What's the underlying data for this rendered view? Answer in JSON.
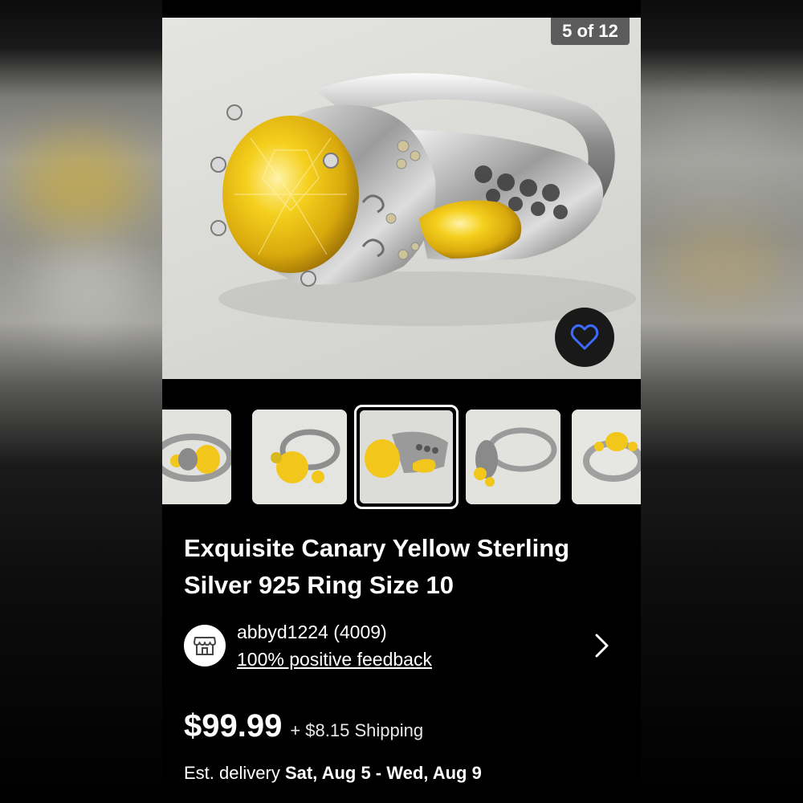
{
  "gallery": {
    "counter": "5 of 12",
    "thumbnail_count": 5,
    "selected_thumbnail": 3
  },
  "listing": {
    "title": "Exquisite Canary Yellow Sterling Silver 925 Ring Size 10",
    "price": "$99.99",
    "shipping": "+ $8.15 Shipping",
    "delivery_label": "Est. delivery",
    "delivery_dates": "Sat, Aug 5 - Wed, Aug 9"
  },
  "seller": {
    "name": "abbyd1224 (4009)",
    "feedback": "100% positive feedback"
  },
  "colors": {
    "background": "#000000",
    "favorite_icon": "#3d6bff",
    "gem": "#f2c61a"
  },
  "icons": {
    "favorite": "heart-outline-icon",
    "seller": "store-icon",
    "chevron": "chevron-right-icon"
  }
}
